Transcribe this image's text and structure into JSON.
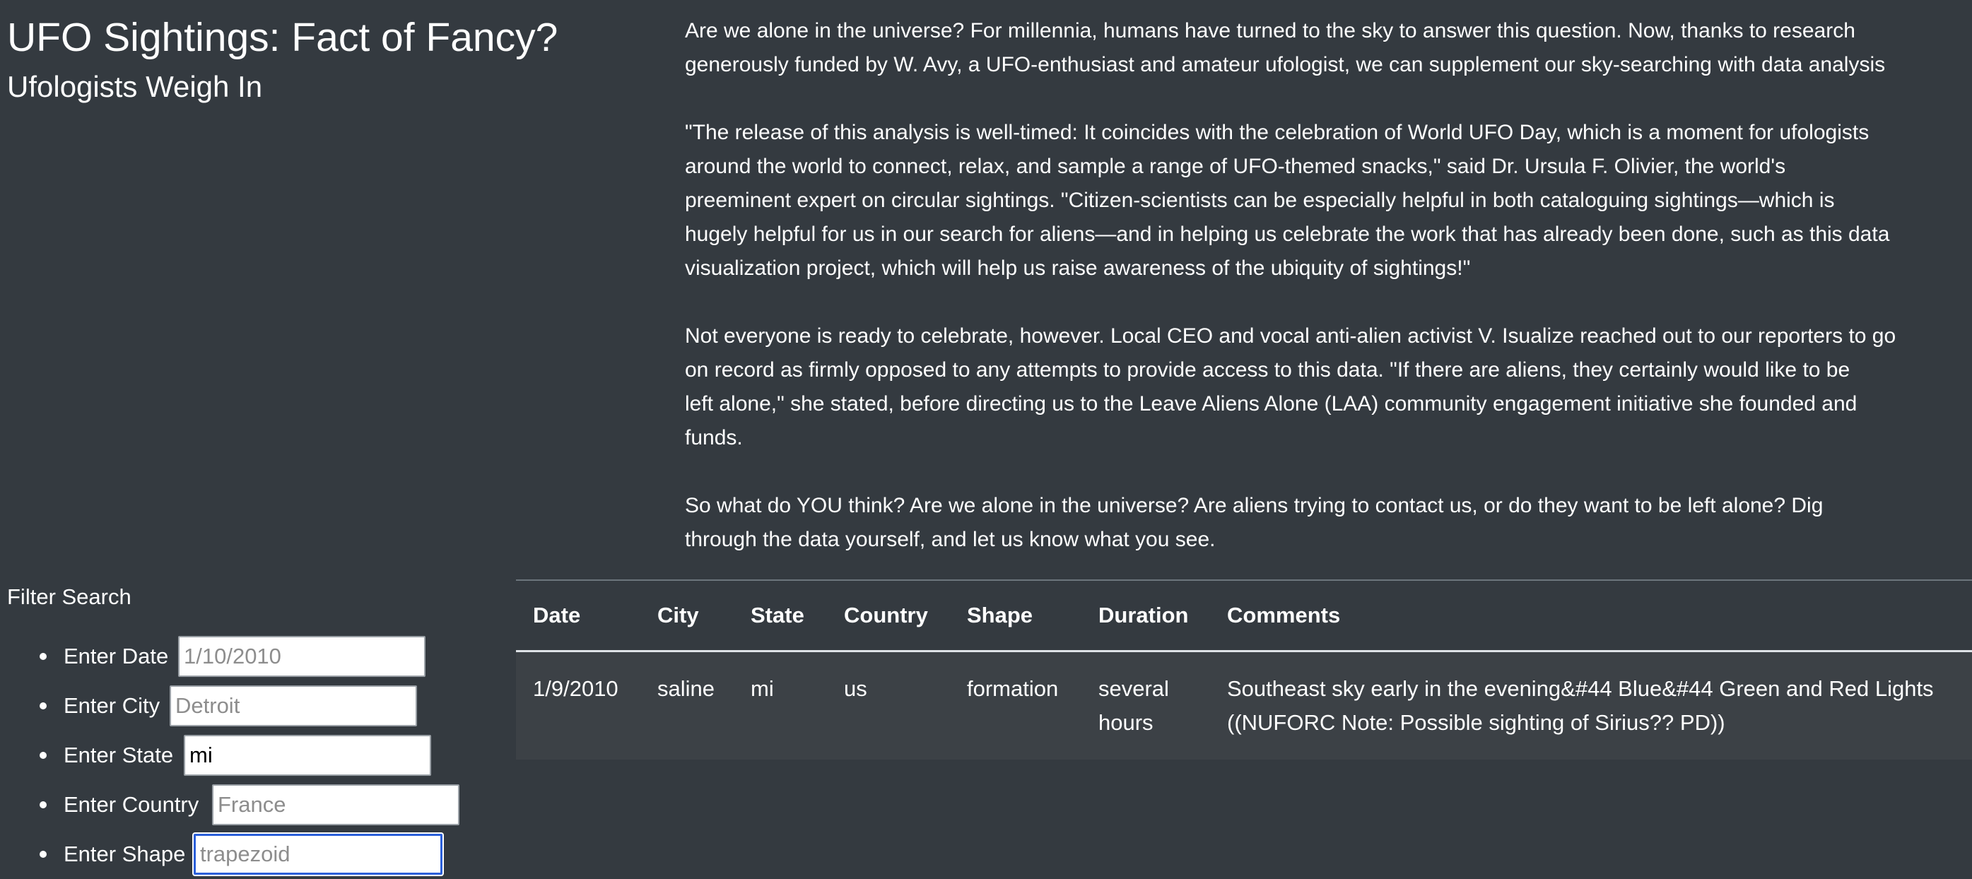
{
  "header": {
    "title": "UFO Sightings: Fact of Fancy?",
    "subtitle": "Ufologists Weigh In"
  },
  "article": {
    "paragraphs": [
      "Are we alone in the universe? For millennia, humans have turned to the sky to answer this question. Now, thanks to research\ngenerously funded by W. Avy, a UFO-enthusiast and amateur ufologist, we can supplement our sky-searching with data analysis",
      "\"The release of this analysis is well-timed: It coincides with the celebration of World UFO Day, which is a moment for ufologists\naround the world to connect, relax, and sample a range of UFO-themed snacks,\" said Dr. Ursula F. Olivier, the world's\npreeminent expert on circular sightings. \"Citizen-scientists can be especially helpful in both cataloguing sightings—which is\nhugely helpful for us in our search for aliens—and in helping us celebrate the work that has already been done, such as this data\nvisualization project, which will help us raise awareness of the ubiquity of sightings!\"",
      "Not everyone is ready to celebrate, however. Local CEO and vocal anti-alien activist V. Isualize reached out to our reporters to go\non record as firmly opposed to any attempts to provide access to this data. \"If there are aliens, they certainly would like to be\nleft alone,\" she stated, before directing us to the Leave Aliens Alone (LAA) community engagement initiative she founded and\nfunds.",
      "So what do YOU think? Are we alone in the universe? Are aliens trying to contact us, or do they want to be left alone? Dig\nthrough the data yourself, and let us know what you see."
    ]
  },
  "filters": {
    "heading": "Filter Search",
    "items": [
      {
        "label": "Enter Date",
        "value": "",
        "placeholder": "1/10/2010"
      },
      {
        "label": "Enter City",
        "value": "",
        "placeholder": "Detroit"
      },
      {
        "label": "Enter State",
        "value": "mi",
        "placeholder": ""
      },
      {
        "label": "Enter Country",
        "value": "",
        "placeholder": "France"
      },
      {
        "label": "Enter Shape",
        "value": "",
        "placeholder": "trapezoid"
      }
    ]
  },
  "table": {
    "columns": [
      "Date",
      "City",
      "State",
      "Country",
      "Shape",
      "Duration",
      "Comments"
    ],
    "rows": [
      {
        "date": "1/9/2010",
        "city": "saline",
        "state": "mi",
        "country": "us",
        "shape": "formation",
        "duration": "several hours",
        "comments": "Southeast sky early in the evening&#44 Blue&#44 Green and Red Lights ((NUFORC Note: Possible sighting of Sirius?? PD))"
      }
    ]
  }
}
